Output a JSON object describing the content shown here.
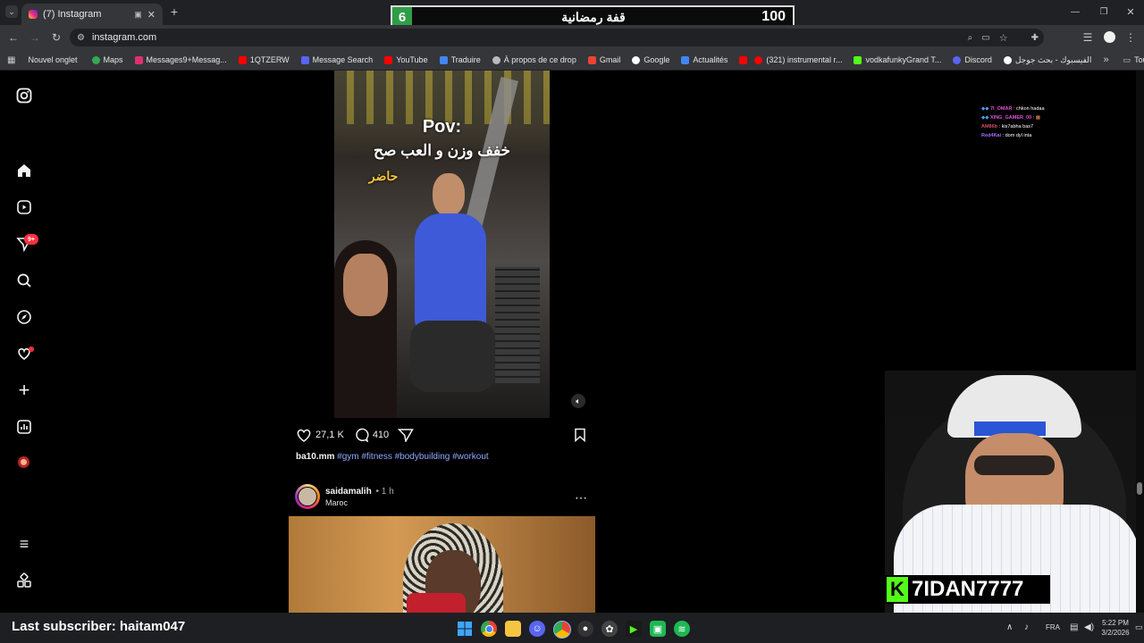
{
  "browser": {
    "tab_title": "(7) Instagram",
    "address": "instagram.com",
    "bookmarks": [
      "Nouvel onglet",
      "Maps",
      "Messages9+Messag...",
      "1QTZERW",
      "Message Search",
      "YouTube",
      "Traduire",
      "À propos de ce drop",
      "Gmail",
      "Google",
      "Actualités",
      "",
      "(321) instrumental r...",
      "vodkafunkyGrand T...",
      "Discord",
      "الفيسبوك - بحث جوجل"
    ],
    "all_bookmarks": "Tous les favoris"
  },
  "overlay": {
    "score_left": "6",
    "score_title": "قفة رمضانية",
    "score_right": "100",
    "chat": [
      {
        "user": "7I_OMAR",
        "msg": "chkon hadaa",
        "color": "#e052d6"
      },
      {
        "user": "XING_GAMER_00",
        "msg": "",
        "color": "#e052d6"
      },
      {
        "user": "AM86b",
        "msg": "kis7abha bas7",
        "color": "#d14b66"
      },
      {
        "user": "Red4Kai",
        "msg": "dom dyl inta",
        "color": "#a66bff"
      }
    ],
    "streamer": "7IDAN7777",
    "last_subscriber": "Last subscriber: haitam047"
  },
  "sidebar": {
    "items": [
      "instagram-logo",
      "home",
      "reels",
      "messages",
      "search",
      "explore",
      "notifications",
      "create",
      "dashboard",
      "profile",
      "more",
      "also-from-meta"
    ],
    "messages_badge": "9+"
  },
  "post1": {
    "video_text_pov": "Pov:",
    "video_text_ar1": "خفف وزن و العب صح",
    "video_text_ar2": "حاضر",
    "likes": "27,1 K",
    "comments": "410",
    "username": "ba10.mm",
    "hashtags": "#gym #fitness #bodybuilding #workout"
  },
  "post2": {
    "username": "saidamalih",
    "time": "• 1 h",
    "location": "Maroc"
  },
  "taskbar": {
    "lang": "FRA",
    "time": "5:22 PM",
    "date": "3/2/2026"
  }
}
